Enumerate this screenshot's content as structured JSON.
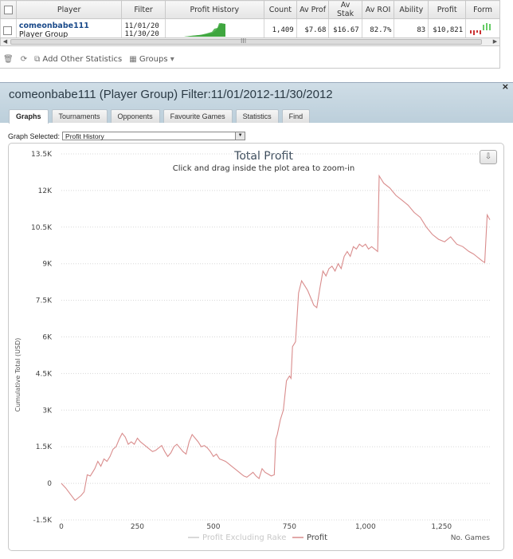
{
  "grid": {
    "headers": [
      "",
      "Player",
      "Filter",
      "Profit History",
      "Count",
      "Av Prof",
      "Av Stak",
      "Av ROI",
      "Ability",
      "Profit",
      "Form"
    ],
    "row": {
      "player_name": "comeonbabe111",
      "player_group": "Player Group",
      "filter_from": "11/01/20",
      "filter_to": "11/30/20",
      "count": "1,409",
      "av_prof": "$7.68",
      "av_stak": "$16.67",
      "av_roi": "82.7%",
      "ability": "83",
      "profit": "$10,821"
    },
    "scroll_mark": "III"
  },
  "toolbar": {
    "add_stats": "Add Other Statistics",
    "groups": "Groups"
  },
  "panel": {
    "title": "comeonbabe111 (Player Group) Filter:11/01/2012-11/30/2012",
    "close": "×",
    "tabs": [
      "Graphs",
      "Tournaments",
      "Opponents",
      "Favourite Games",
      "Statistics",
      "Find"
    ],
    "graph_selected_label": "Graph Selected:",
    "graph_selected_value": "Profit History"
  },
  "colors": {
    "profit_line": "#d98c8c",
    "excl_rake_line": "#cccccc",
    "spark": "#4caf50",
    "form_pos": "#66cc66",
    "form_neg": "#cc3333",
    "header_bg": "#c6d7e2"
  },
  "chart_data": {
    "type": "line",
    "title": "Total Profit",
    "subtitle": "Click and drag inside the plot area to zoom-in",
    "xlabel": "No. Games",
    "ylabel": "Cumulative Total (USD)",
    "xlim": [
      0,
      1409
    ],
    "ylim": [
      -1500,
      13500
    ],
    "x_ticks": [
      0,
      250,
      500,
      750,
      1000,
      1250
    ],
    "x_tick_labels": [
      "0",
      "250",
      "500",
      "750",
      "1,000",
      "1,250"
    ],
    "y_ticks": [
      -1500,
      0,
      1500,
      3000,
      4500,
      6000,
      7500,
      9000,
      10500,
      12000,
      13500
    ],
    "y_tick_labels": [
      "-1.5K",
      "0",
      "1.5K",
      "3K",
      "4.5K",
      "6K",
      "7.5K",
      "9K",
      "10.5K",
      "12K",
      "13.5K"
    ],
    "grid": true,
    "legend": "bottom",
    "series": [
      {
        "name": "Profit Excluding Rake",
        "color": "#cccccc",
        "x": [],
        "y": []
      },
      {
        "name": "Profit",
        "color": "#d98c8c",
        "x": [
          0,
          15,
          30,
          45,
          55,
          65,
          75,
          85,
          95,
          100,
          110,
          120,
          130,
          140,
          150,
          160,
          170,
          180,
          190,
          200,
          210,
          220,
          230,
          240,
          250,
          260,
          270,
          280,
          290,
          300,
          310,
          320,
          330,
          340,
          350,
          360,
          370,
          380,
          390,
          400,
          410,
          420,
          430,
          440,
          450,
          460,
          470,
          480,
          490,
          500,
          510,
          520,
          530,
          540,
          550,
          560,
          570,
          580,
          590,
          600,
          610,
          620,
          630,
          640,
          650,
          660,
          670,
          680,
          690,
          700,
          705,
          710,
          720,
          730,
          740,
          750,
          755,
          760,
          770,
          780,
          790,
          800,
          810,
          820,
          830,
          840,
          850,
          860,
          870,
          880,
          890,
          900,
          910,
          920,
          930,
          940,
          950,
          960,
          970,
          980,
          990,
          1000,
          1010,
          1020,
          1030,
          1040,
          1045,
          1050,
          1060,
          1080,
          1100,
          1120,
          1140,
          1160,
          1180,
          1200,
          1220,
          1240,
          1260,
          1280,
          1300,
          1320,
          1340,
          1355,
          1365,
          1375,
          1385,
          1392,
          1400,
          1409
        ],
        "y": [
          0,
          -200,
          -450,
          -700,
          -600,
          -500,
          -350,
          350,
          300,
          400,
          600,
          900,
          700,
          1000,
          900,
          1100,
          1400,
          1500,
          1800,
          2050,
          1900,
          1600,
          1700,
          1600,
          1850,
          1700,
          1600,
          1500,
          1400,
          1300,
          1350,
          1450,
          1550,
          1300,
          1100,
          1250,
          1500,
          1600,
          1450,
          1300,
          1200,
          1700,
          2000,
          1850,
          1700,
          1500,
          1550,
          1450,
          1300,
          1100,
          1200,
          1000,
          950,
          900,
          800,
          700,
          600,
          500,
          400,
          300,
          250,
          350,
          450,
          300,
          200,
          600,
          450,
          380,
          300,
          350,
          1800,
          2000,
          2600,
          3000,
          4200,
          4400,
          4300,
          5600,
          5800,
          7800,
          8300,
          8100,
          7900,
          7600,
          7300,
          7200,
          8000,
          8700,
          8500,
          8800,
          8900,
          8700,
          9000,
          8800,
          9300,
          9500,
          9300,
          9700,
          9600,
          9800,
          9700,
          9800,
          9600,
          9700,
          9600,
          9500,
          12600,
          12500,
          12300,
          12100,
          11800,
          11600,
          11400,
          11100,
          10900,
          10500,
          10200,
          10000,
          9900,
          10100,
          9800,
          9700,
          9500,
          9400,
          9300,
          9200,
          9100,
          9050,
          11000,
          10800
        ]
      }
    ]
  }
}
